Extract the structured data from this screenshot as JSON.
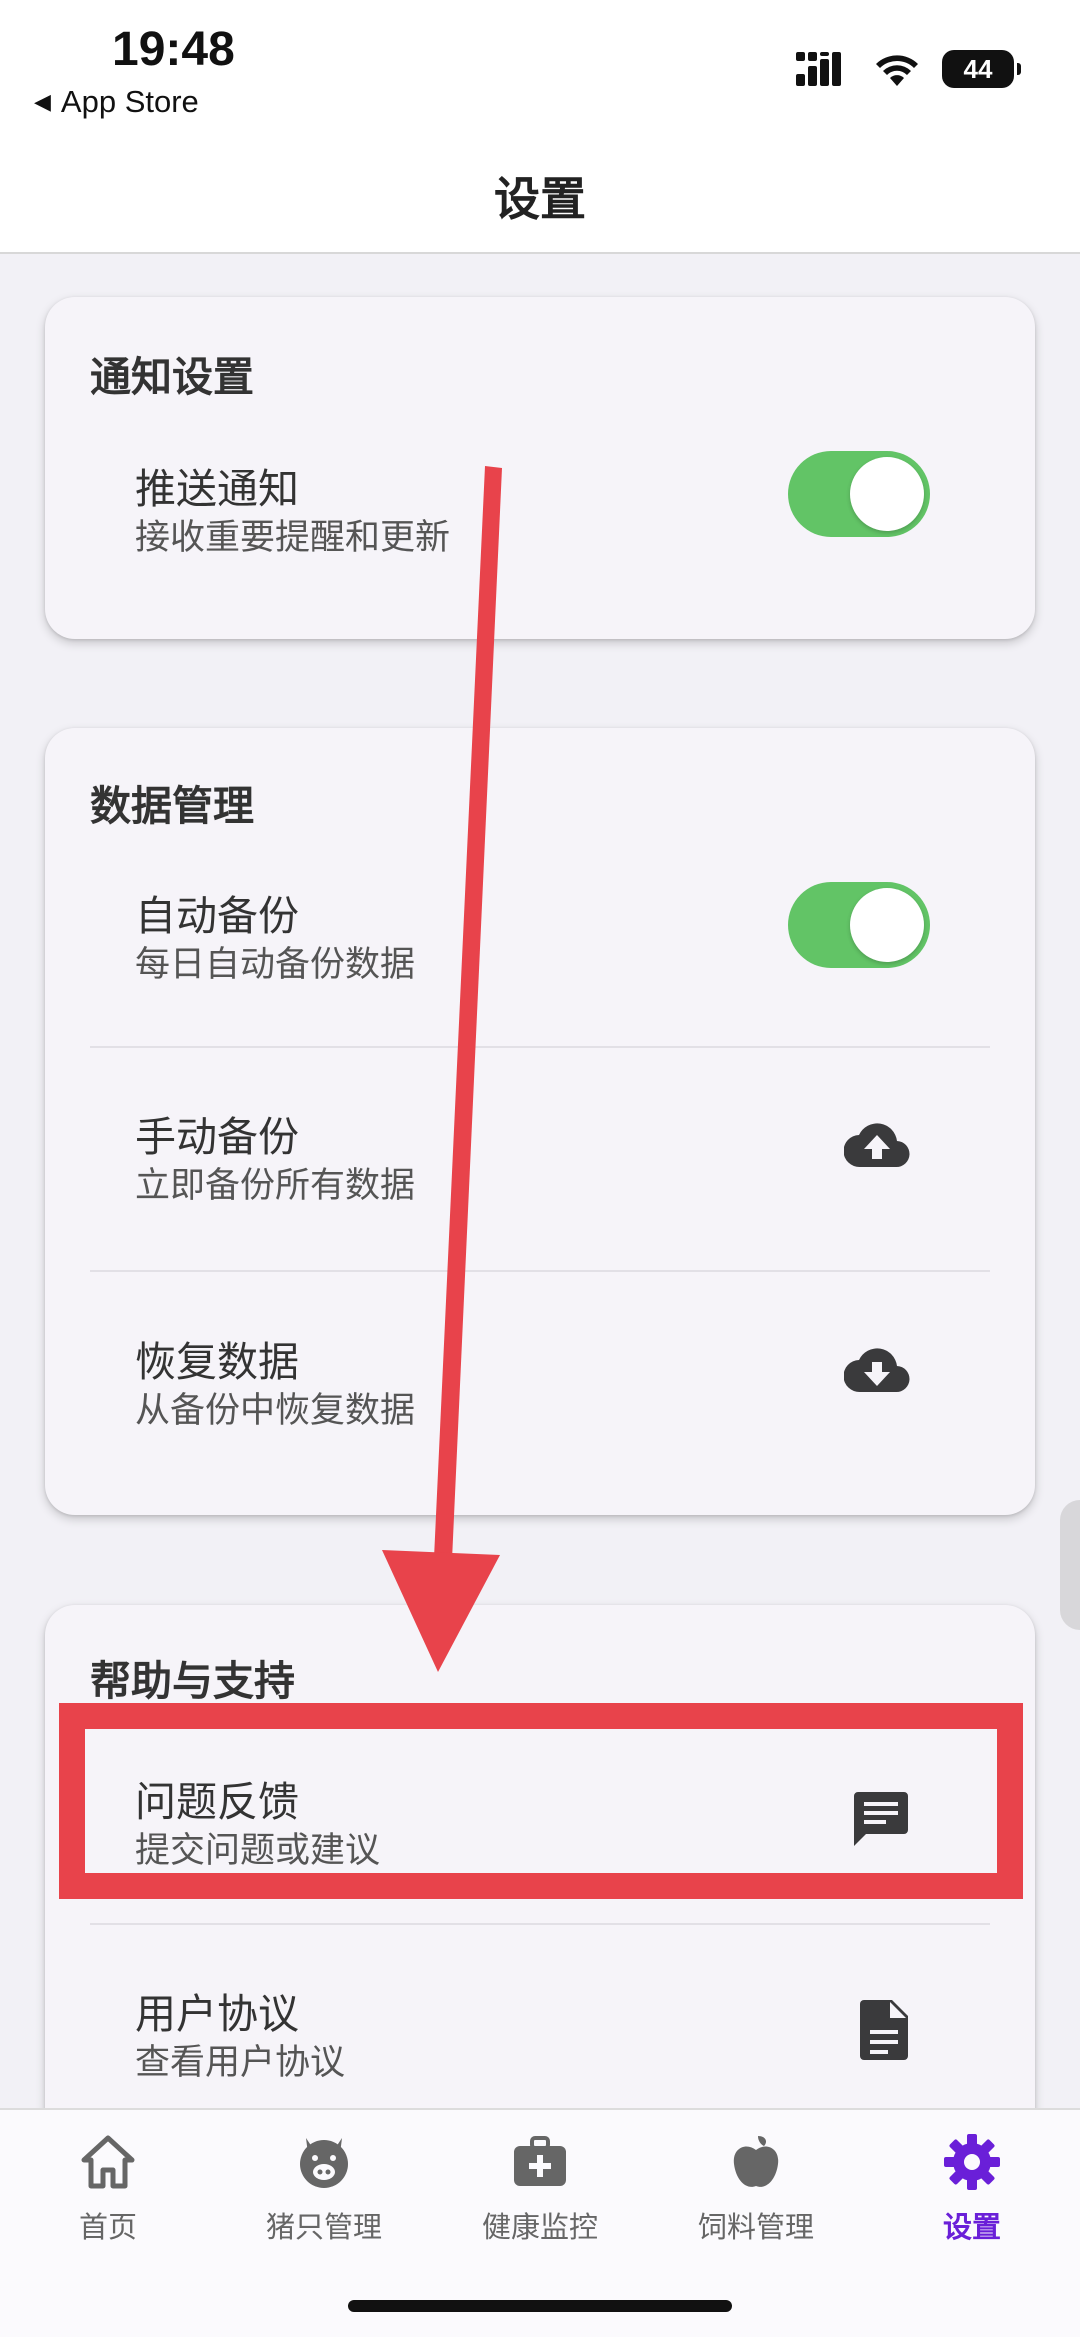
{
  "status_bar": {
    "time": "19:48",
    "back_app": "App Store",
    "battery": "44"
  },
  "header": {
    "title": "设置"
  },
  "sections": {
    "notifications": {
      "title": "通知设置",
      "push": {
        "title": "推送通知",
        "subtitle": "接收重要提醒和更新",
        "enabled": true
      }
    },
    "data": {
      "title": "数据管理",
      "auto_backup": {
        "title": "自动备份",
        "subtitle": "每日自动备份数据",
        "enabled": true
      },
      "manual_backup": {
        "title": "手动备份",
        "subtitle": "立即备份所有数据",
        "icon": "cloud-upload-icon"
      },
      "restore": {
        "title": "恢复数据",
        "subtitle": "从备份中恢复数据",
        "icon": "cloud-download-icon"
      }
    },
    "help": {
      "title": "帮助与支持",
      "feedback": {
        "title": "问题反馈",
        "subtitle": "提交问题或建议",
        "icon": "feedback-icon"
      },
      "agreement": {
        "title": "用户协议",
        "subtitle": "查看用户协议",
        "icon": "document-icon"
      }
    }
  },
  "tabs": [
    {
      "label": "首页",
      "icon": "home-icon"
    },
    {
      "label": "猪只管理",
      "icon": "pig-icon"
    },
    {
      "label": "健康监控",
      "icon": "medical-kit-icon"
    },
    {
      "label": "饲料管理",
      "icon": "apple-icon"
    },
    {
      "label": "设置",
      "icon": "gear-icon",
      "active": true
    }
  ],
  "colors": {
    "toggle_on": "#62c466",
    "accent": "#6a1fd8",
    "annotation": "#e8434b"
  }
}
